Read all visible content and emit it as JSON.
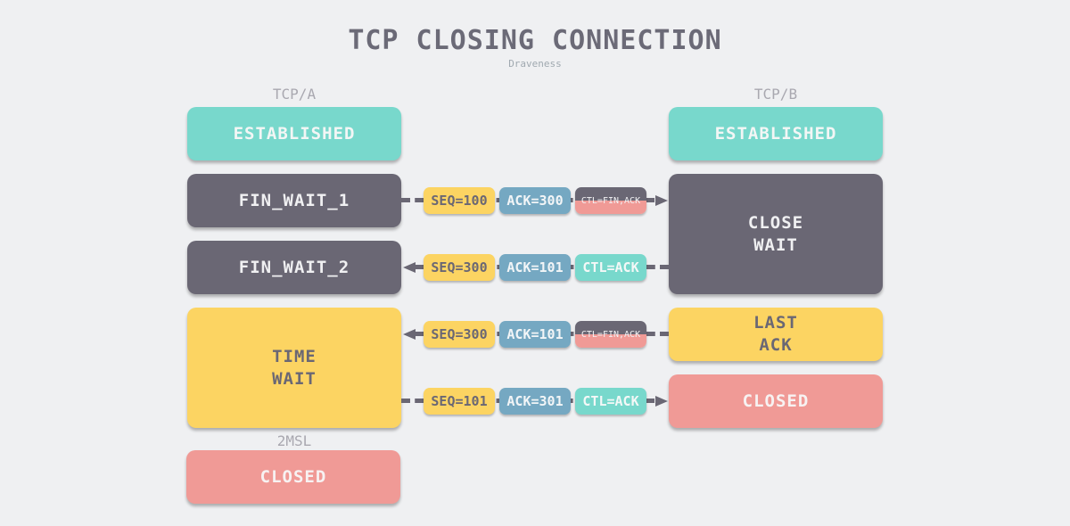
{
  "title": "TCP CLOSING CONNECTION",
  "subtitle": "Draveness",
  "columns": {
    "a": "TCP/A",
    "b": "TCP/B"
  },
  "a_states": [
    {
      "label": "ESTABLISHED",
      "color": "#78d8cc"
    },
    {
      "label": "FIN_WAIT_1",
      "color": "#6a6774"
    },
    {
      "label": "FIN_WAIT_2",
      "color": "#6a6774"
    },
    {
      "label": "TIME\nWAIT",
      "color": "#fcd462"
    },
    {
      "label": "CLOSED",
      "color": "#f09a96"
    }
  ],
  "b_states": [
    {
      "label": "ESTABLISHED",
      "color": "#78d8cc"
    },
    {
      "label": "CLOSE\nWAIT",
      "color": "#6a6774"
    },
    {
      "label": "LAST\nACK",
      "color": "#fcd462"
    },
    {
      "label": "CLOSED",
      "color": "#f09a96"
    }
  ],
  "timer_label": "2MSL",
  "messages": [
    {
      "direction": "A→B",
      "seq": "SEQ=100",
      "ack": "ACK=300",
      "ctl": "CTL=FIN,ACK"
    },
    {
      "direction": "B→A",
      "seq": "SEQ=300",
      "ack": "ACK=101",
      "ctl": "CTL=ACK"
    },
    {
      "direction": "B→A",
      "seq": "SEQ=300",
      "ack": "ACK=101",
      "ctl": "CTL=FIN,ACK"
    },
    {
      "direction": "A→B",
      "seq": "SEQ=101",
      "ack": "ACK=301",
      "ctl": "CTL=ACK"
    }
  ],
  "colors": {
    "background": "#eff0f2",
    "teal": "#78d8cc",
    "dark": "#6a6774",
    "yellow": "#fcd462",
    "pink": "#f09a96",
    "blue": "#75a8c2"
  }
}
